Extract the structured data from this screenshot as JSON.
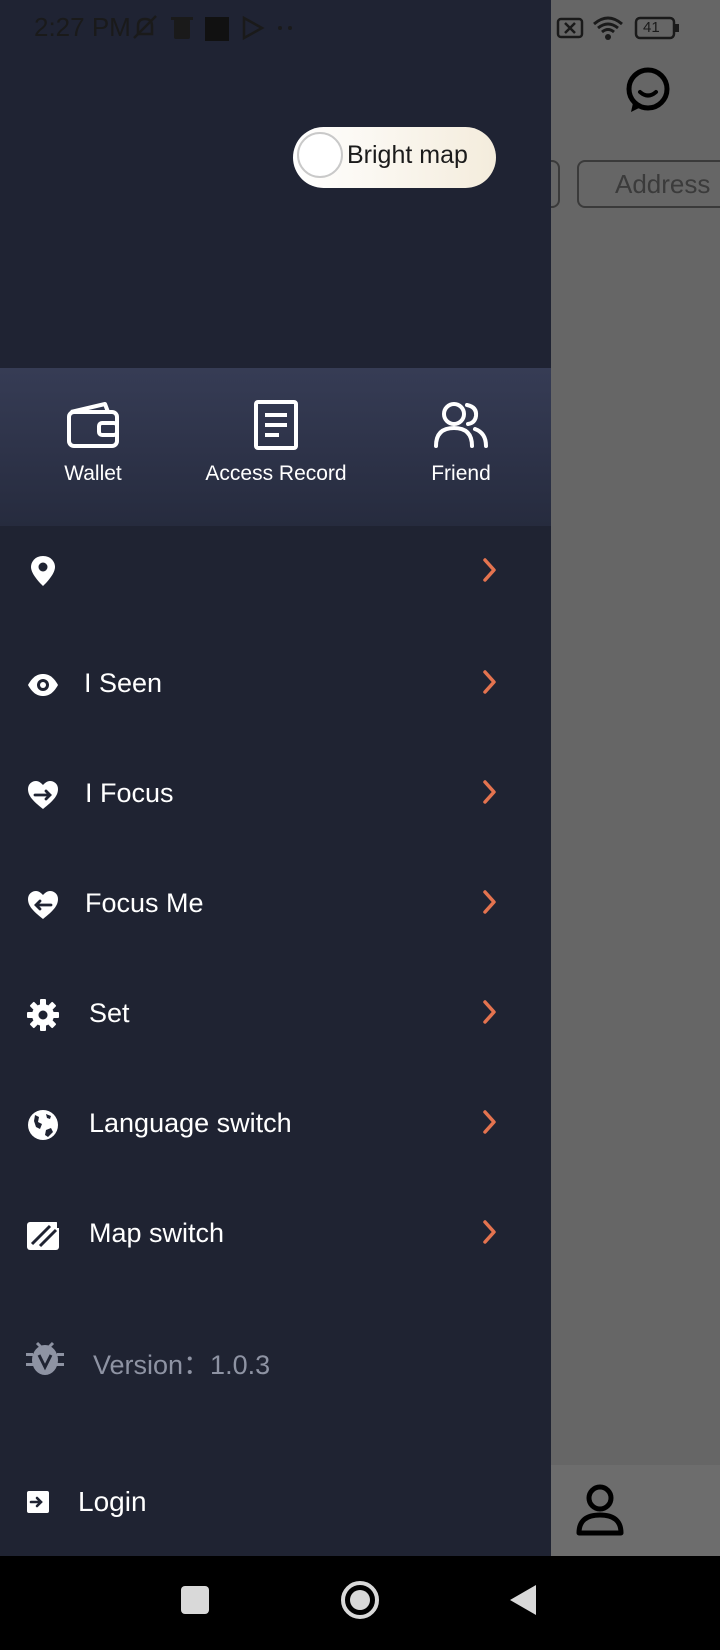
{
  "status_bar": {
    "time": "2:27 PM",
    "battery": "41"
  },
  "background": {
    "address_placeholder": "Address"
  },
  "drawer": {
    "toggle_label": "Bright map",
    "quick_actions": [
      {
        "label": "Wallet",
        "icon": "wallet-icon"
      },
      {
        "label": "Access Record",
        "icon": "document-icon"
      },
      {
        "label": "Friend",
        "icon": "friends-icon"
      }
    ],
    "menu": [
      {
        "label": "",
        "icon": "location-pin-icon"
      },
      {
        "label": "I Seen",
        "icon": "eye-icon"
      },
      {
        "label": "I Focus",
        "icon": "heart-arrow-out-icon"
      },
      {
        "label": "Focus Me",
        "icon": "heart-arrow-in-icon"
      },
      {
        "label": "Set",
        "icon": "gear-icon"
      },
      {
        "label": "Language switch",
        "icon": "globe-icon"
      },
      {
        "label": "Map switch",
        "icon": "map-switch-icon"
      }
    ],
    "version": "Version：1.0.3",
    "login_label": "Login"
  },
  "colors": {
    "drawer_bg": "#1f2332",
    "chevron": "#e4734f",
    "toggle_bg": "#f4ecdc"
  }
}
